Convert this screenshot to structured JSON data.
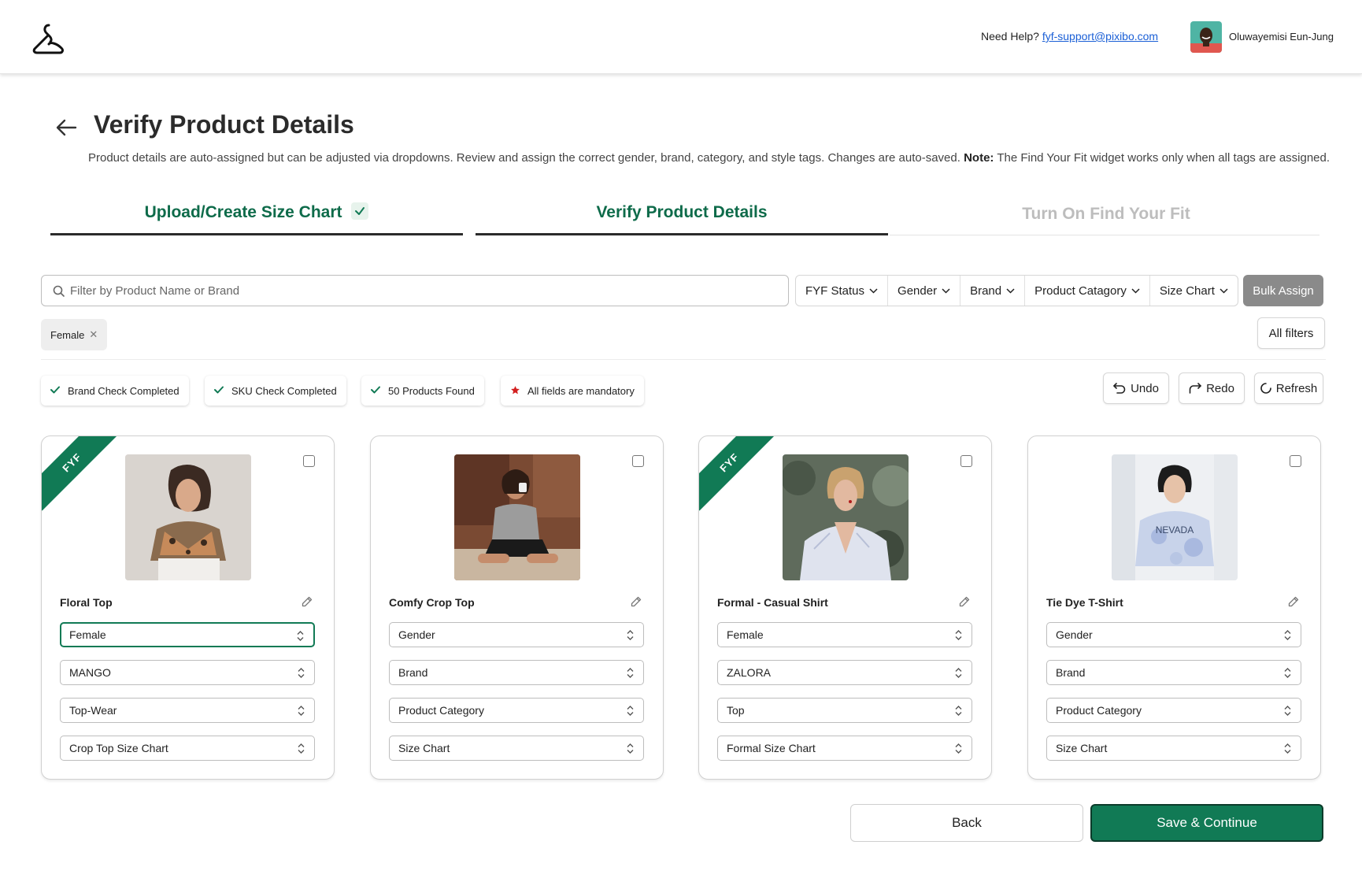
{
  "header": {
    "help_prefix": "Need Help?",
    "help_email": "fyf-support@pixibo.com",
    "user_name": "Oluwayemisi Eun-Jung"
  },
  "page": {
    "title": "Verify Product Details",
    "description": "Product details are auto-assigned but can be adjusted via dropdowns. Review and assign the correct gender, brand, category, and style tags. Changes are auto-saved.",
    "note_label": "Note:",
    "note_text": "The Find Your Fit widget works only when all tags are assigned."
  },
  "steps": [
    {
      "label": "Upload/Create Size Chart",
      "state": "completed"
    },
    {
      "label": "Verify Product Details",
      "state": "active"
    },
    {
      "label": "Turn On Find Your Fit",
      "state": "upcoming"
    }
  ],
  "filters": {
    "search_placeholder": "Filter by Product Name or Brand",
    "dropdowns": [
      "FYF Status",
      "Gender",
      "Brand",
      "Product Catagory",
      "Size Chart"
    ],
    "bulk_assign": "Bulk Assign",
    "active_chip": "Female",
    "all_filters": "All filters"
  },
  "status_pills": [
    {
      "label": "Brand Check Completed",
      "icon": "check-icon"
    },
    {
      "label": "SKU Check Completed",
      "icon": "check-icon"
    },
    {
      "label": "50 Products Found",
      "icon": "check-icon"
    },
    {
      "label": "All fields are mandatory",
      "icon": "star-icon"
    }
  ],
  "actions": {
    "undo": "Undo",
    "redo": "Redo",
    "refresh": "Refresh"
  },
  "products": [
    {
      "name": "Floral Top",
      "fyf": true,
      "ribbon": "FYF",
      "gender": "Female",
      "brand": "MANGO",
      "category": "Top-Wear",
      "size_chart": "Crop Top Size Chart"
    },
    {
      "name": "Comfy Crop Top",
      "fyf": false,
      "ribbon": "",
      "gender": "Gender",
      "brand": "Brand",
      "category": "Product Category",
      "size_chart": "Size Chart"
    },
    {
      "name": "Formal - Casual Shirt",
      "fyf": true,
      "ribbon": "FYF",
      "gender": "Female",
      "brand": "ZALORA",
      "category": "Top",
      "size_chart": "Formal Size Chart"
    },
    {
      "name": "Tie Dye T-Shirt",
      "fyf": false,
      "ribbon": "",
      "gender": "Gender",
      "brand": "Brand",
      "category": "Product Category",
      "size_chart": "Size Chart"
    }
  ],
  "footer": {
    "back": "Back",
    "save": "Save & Continue"
  },
  "colors": {
    "brand_green": "#117a55",
    "step_text_green": "#0e6b4a",
    "link_blue": "#1a5fd6",
    "muted_step": "#bdbdbd",
    "bulk_gray": "#8a8a8a",
    "star_red": "#d32020"
  }
}
